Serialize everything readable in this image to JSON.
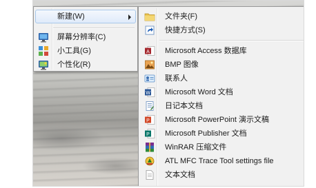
{
  "context_menu": {
    "items": [
      {
        "label": "新建(W)",
        "icon": "none",
        "has_submenu": true
      },
      {
        "label": "屏幕分辨率(C)",
        "icon": "display-icon"
      },
      {
        "label": "小工具(G)",
        "icon": "gadgets-icon"
      },
      {
        "label": "个性化(R)",
        "icon": "personalize-icon"
      }
    ]
  },
  "new_submenu": {
    "items": [
      {
        "label": "文件夹(F)",
        "icon": "folder-icon"
      },
      {
        "label": "快捷方式(S)",
        "icon": "shortcut-icon"
      },
      {
        "label": "Microsoft Access 数据库",
        "icon": "access-icon"
      },
      {
        "label": "BMP 图像",
        "icon": "bmp-icon"
      },
      {
        "label": "联系人",
        "icon": "contact-icon"
      },
      {
        "label": "Microsoft Word 文档",
        "icon": "word-icon"
      },
      {
        "label": "日记本文档",
        "icon": "journal-icon"
      },
      {
        "label": "Microsoft PowerPoint 演示文稿",
        "icon": "powerpoint-icon"
      },
      {
        "label": "Microsoft Publisher 文档",
        "icon": "publisher-icon"
      },
      {
        "label": "WinRAR 压缩文件",
        "icon": "winrar-icon"
      },
      {
        "label": "ATL MFC Trace Tool settings file",
        "icon": "atl-trace-icon"
      },
      {
        "label": "文本文档",
        "icon": "text-doc-icon"
      }
    ]
  },
  "colors": {
    "menu_bg": "#f1f1f1",
    "highlight_border": "#a8c8ea",
    "highlight_bg": "#dfeafa"
  }
}
